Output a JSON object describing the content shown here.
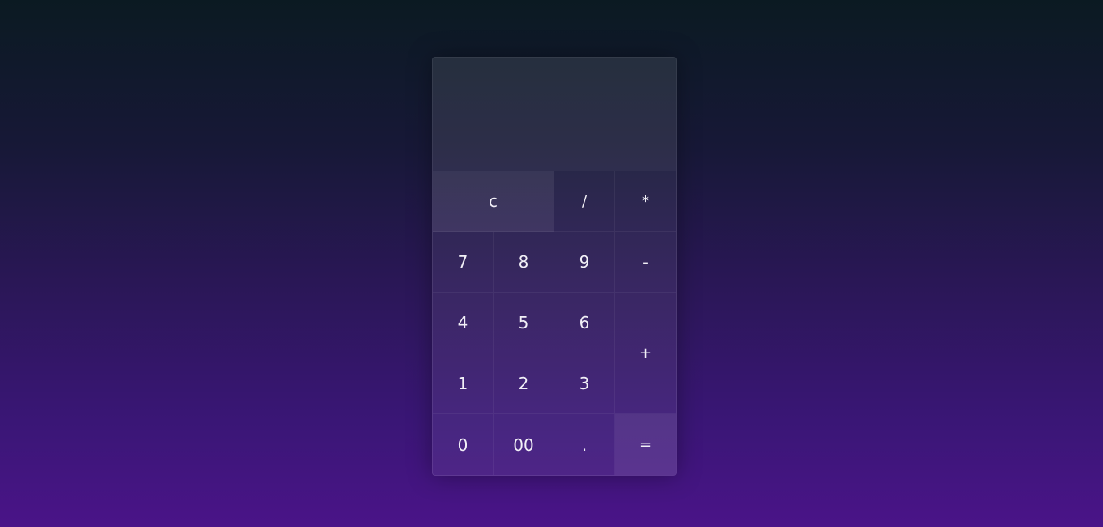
{
  "display": {
    "value": ""
  },
  "keys": {
    "clear": "c",
    "divide": "/",
    "multiply": "*",
    "seven": "7",
    "eight": "8",
    "nine": "9",
    "minus": "-",
    "four": "4",
    "five": "5",
    "six": "6",
    "plus": "+",
    "one": "1",
    "two": "2",
    "three": "3",
    "zero": "0",
    "double_zero": "00",
    "decimal": ".",
    "equals": "="
  }
}
